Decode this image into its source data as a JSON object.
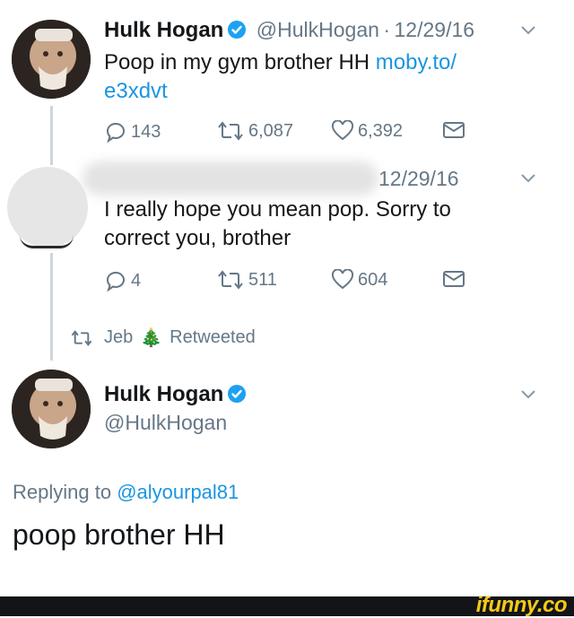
{
  "tweet1": {
    "name": "Hulk Hogan",
    "handle": "@HulkHogan",
    "sep": "·",
    "date": "12/29/16",
    "text_before_link": "Poop in my gym brother HH ",
    "link_line1": "moby.to/",
    "link_line2": "e3xdvt",
    "replies": "143",
    "retweets": "6,087",
    "likes": "6,392"
  },
  "tweet2": {
    "date": "12/29/16",
    "text_line1": "I really hope you mean pop. Sorry to",
    "text_line2": "correct you, brother",
    "replies": "4",
    "retweets": "511",
    "likes": "604"
  },
  "retweet_notice": {
    "user": "Jeb",
    "emoji": "🎄",
    "label": "Retweeted"
  },
  "tweet3": {
    "name": "Hulk Hogan",
    "handle": "@HulkHogan",
    "replying_prefix": "Replying to ",
    "replying_handle": "@alyourpal81",
    "text": "poop brother HH"
  },
  "watermark": "ifunny.co",
  "colors": {
    "link": "#1b95e0",
    "muted": "#657786",
    "verified": "#1da1f2",
    "watermark": "#f6c915"
  }
}
